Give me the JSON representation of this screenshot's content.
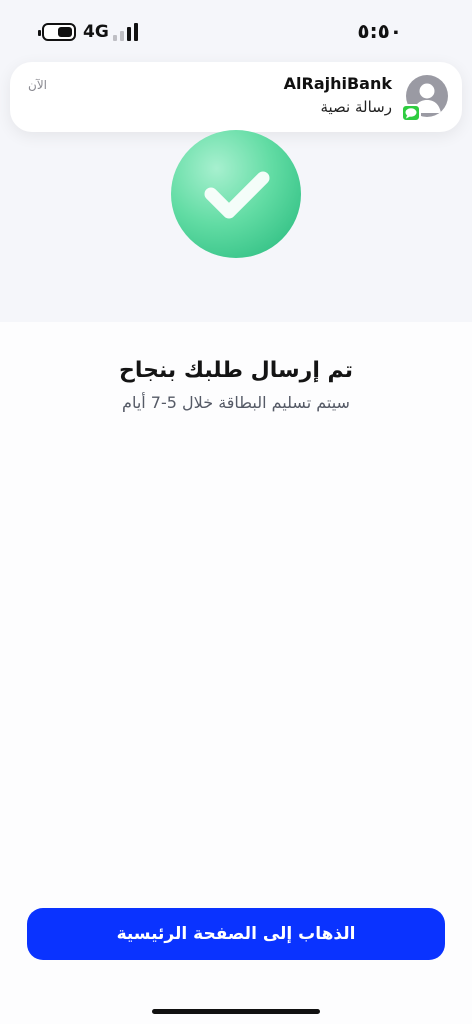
{
  "status_bar": {
    "network": "4G",
    "time": "٥:٥٠"
  },
  "notification": {
    "sender": "AlRajhiBank",
    "body": "رسالة نصية",
    "time": "الآن"
  },
  "success": {
    "title": "تم إرسال طلبك بنجاح",
    "subtitle": "سيتم تسليم البطاقة خلال 5-7 أيام"
  },
  "actions": {
    "home_button_label": "الذهاب إلى الصفحة الرئيسية"
  },
  "colors": {
    "primary": "#0a33ff",
    "success": "#22b77a",
    "background": "#f5f6fa"
  },
  "icons": {
    "success": "checkmark-icon",
    "avatar": "person-icon",
    "badge": "message-bubble-icon"
  }
}
